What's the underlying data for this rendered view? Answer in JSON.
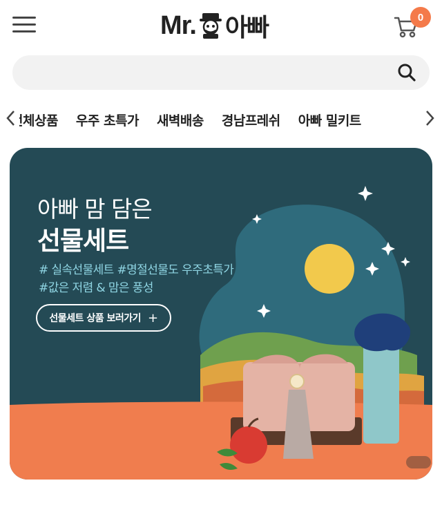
{
  "header": {
    "logo_text_en": "Mr.",
    "logo_text_ko": "아빠",
    "cart_count": "0"
  },
  "search": {
    "placeholder": "",
    "value": ""
  },
  "categories": [
    "전체상품",
    "우주 초특가",
    "새벽배송",
    "경남프레쉬",
    "아빠 밀키트"
  ],
  "banner": {
    "subtitle": "아빠 맘 담은",
    "title": "선물세트",
    "tag_line_1": "# 실속선물세트 #명절선물도 우주초특가",
    "tag_line_2": "#값은 저렴 & 맘은 풍성",
    "cta_label": "선물세트 상품 보러가기",
    "cta_icon": "+"
  },
  "colors": {
    "banner_bg": "#244a55",
    "banner_ground": "#f07d4e",
    "tag_text": "#8fd5e3",
    "badge": "#f47a4a",
    "moon": "#f2c94c"
  }
}
